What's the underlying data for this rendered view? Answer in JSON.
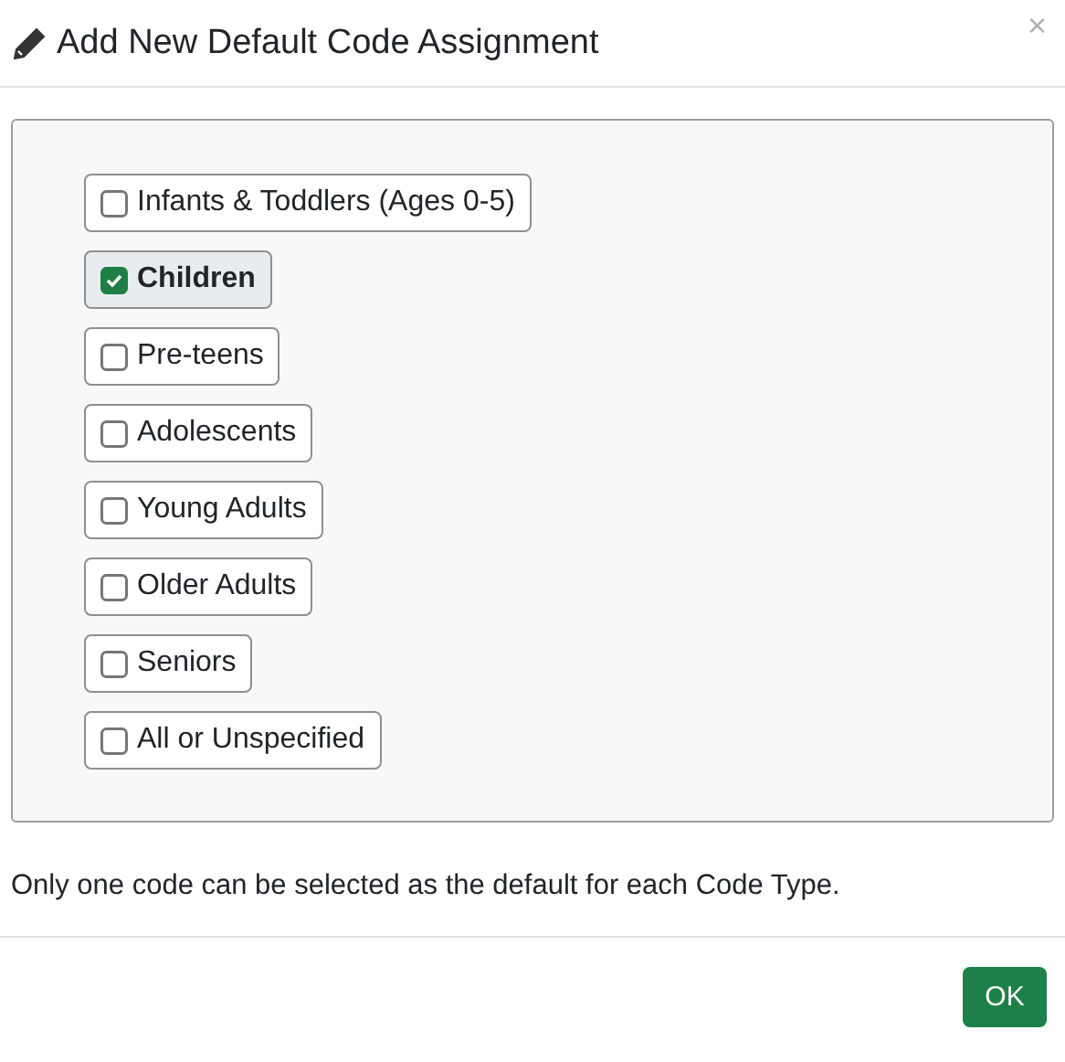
{
  "dialog": {
    "title": "Add New Default Code Assignment",
    "close": "×"
  },
  "options": [
    {
      "label": "Infants & Toddlers (Ages 0-5)",
      "checked": false
    },
    {
      "label": "Children",
      "checked": true
    },
    {
      "label": "Pre-teens",
      "checked": false
    },
    {
      "label": "Adolescents",
      "checked": false
    },
    {
      "label": "Young Adults",
      "checked": false
    },
    {
      "label": "Older Adults",
      "checked": false
    },
    {
      "label": "Seniors",
      "checked": false
    },
    {
      "label": "All or Unspecified",
      "checked": false
    }
  ],
  "note": "Only one code can be selected as the default for each Code Type.",
  "buttons": [
    "OK"
  ]
}
